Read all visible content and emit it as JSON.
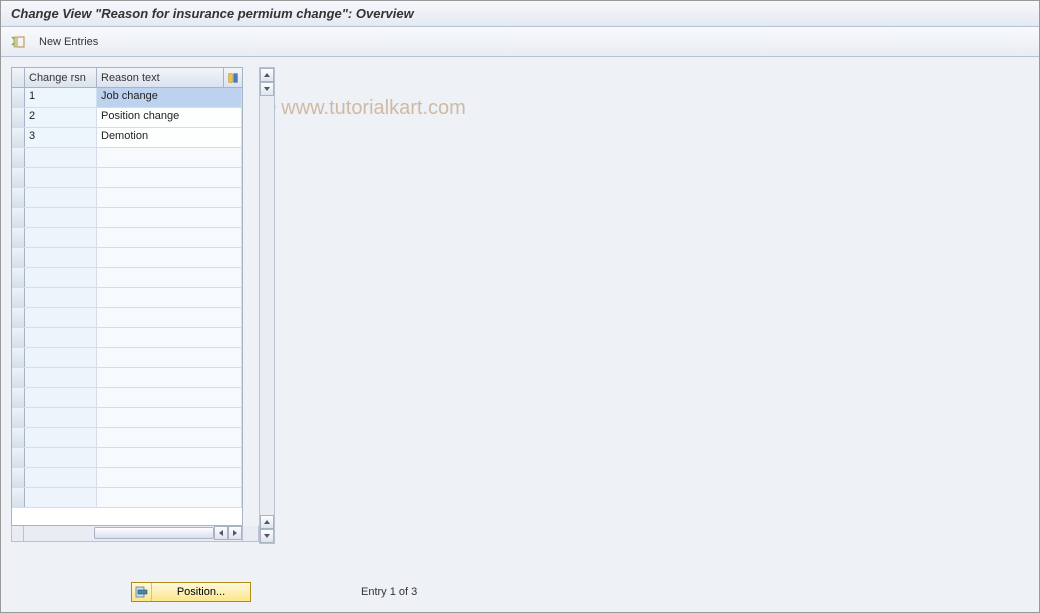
{
  "title": "Change View \"Reason for insurance permium change\": Overview",
  "toolbar": {
    "new_entries_label": "New Entries"
  },
  "watermark": "© www.tutorialkart.com",
  "table": {
    "columns": {
      "col1": "Change rsn",
      "col2": "Reason text"
    },
    "rows": [
      {
        "code": "1",
        "text": "Job change",
        "selected": true
      },
      {
        "code": "2",
        "text": "Position change",
        "selected": false
      },
      {
        "code": "3",
        "text": "Demotion",
        "selected": false
      }
    ],
    "empty_row_count": 18
  },
  "footer": {
    "position_label": "Position...",
    "entry_status": "Entry 1 of 3"
  }
}
